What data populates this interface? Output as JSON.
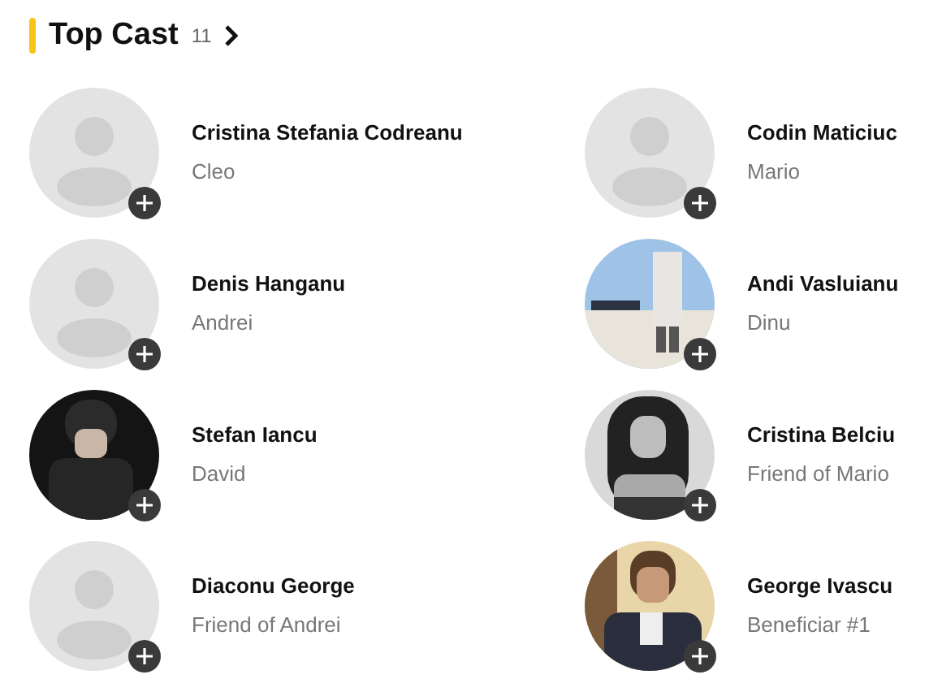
{
  "section": {
    "title": "Top Cast",
    "count": "11"
  },
  "cast": [
    {
      "name": "Cristina Stefania Codreanu",
      "role": "Cleo",
      "photo": false
    },
    {
      "name": "Codin Maticiuc",
      "role": "Mario",
      "photo": false
    },
    {
      "name": "Denis Hanganu",
      "role": "Andrei",
      "photo": false
    },
    {
      "name": "Andi Vasluianu",
      "role": "Dinu",
      "photo": true
    },
    {
      "name": "Stefan Iancu",
      "role": "David",
      "photo": true
    },
    {
      "name": "Cristina Belciu",
      "role": "Friend of Mario",
      "photo": true
    },
    {
      "name": "Diaconu George",
      "role": "Friend of Andrei",
      "photo": false
    },
    {
      "name": "George Ivascu",
      "role": "Beneficiar #1",
      "photo": true
    }
  ]
}
